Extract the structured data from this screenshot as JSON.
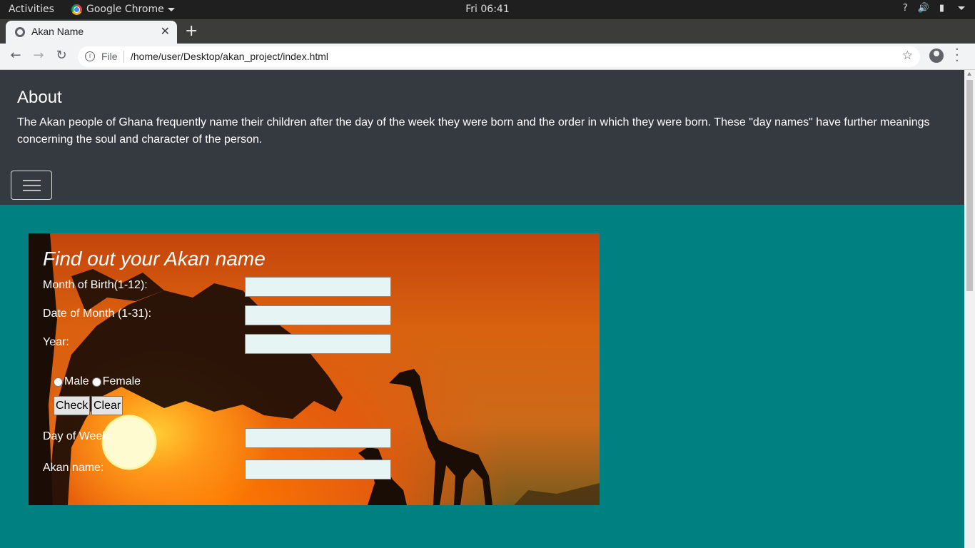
{
  "system": {
    "activities": "Activities",
    "app_name": "Google Chrome",
    "clock": "Fri 06:41",
    "tray": [
      "?",
      "🔊",
      "▮"
    ]
  },
  "browser": {
    "tab_title": "Akan Name",
    "new_tab": "+",
    "close": "✕",
    "info_label": "File",
    "url": "/home/user/Desktop/akan_project/index.html"
  },
  "header": {
    "title": "About",
    "description": "The Akan people of Ghana frequently name their children after the day of the week they were born and the order in which they were born. These \"day names\" have further meanings concerning the soul and character of the person."
  },
  "form": {
    "title": "Find out your Akan name",
    "month_label": "Month of Birth(1-12):",
    "date_label": "Date of Month (1-31):",
    "year_label": "Year:",
    "male_label": "Male",
    "female_label": "Female",
    "check_button": "Check",
    "clear_button": "Clear",
    "day_label": "Day of Week:",
    "akan_label": "Akan name:",
    "month_value": "",
    "date_value": "",
    "year_value": "",
    "day_value": "",
    "akan_value": ""
  },
  "colors": {
    "page_bg": "#008080",
    "header_bg": "#343a40",
    "input_bg": "#e6f4f3"
  }
}
